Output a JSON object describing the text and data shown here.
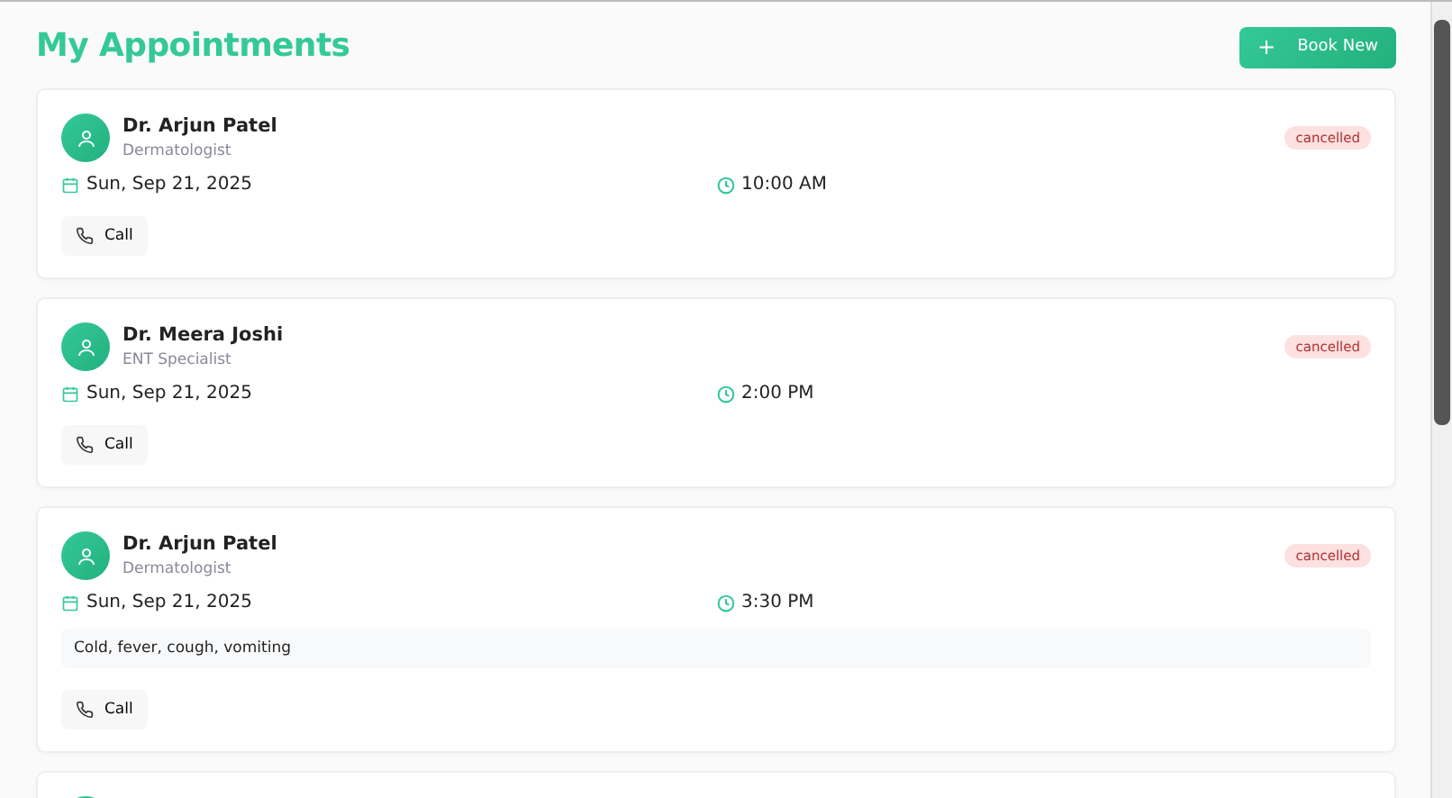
{
  "header": {
    "title": "My Appointments",
    "book_button": {
      "icon": "+",
      "label": "Book New"
    }
  },
  "appointments": [
    {
      "doctor": "Dr. Arjun Patel",
      "specialty": "Dermatologist",
      "status": {
        "label": "cancelled",
        "kind": "cancelled"
      },
      "date": "Sun, Sep 21, 2025",
      "time": "10:00 AM",
      "call_label": "Call"
    },
    {
      "doctor": "Dr. Meera Joshi",
      "specialty": "ENT Specialist",
      "status": {
        "label": "cancelled",
        "kind": "cancelled"
      },
      "date": "Sun, Sep 21, 2025",
      "time": "2:00 PM",
      "call_label": "Call"
    },
    {
      "doctor": "Dr. Arjun Patel",
      "specialty": "Dermatologist",
      "status": {
        "label": "cancelled",
        "kind": "cancelled"
      },
      "date": "Sun, Sep 21, 2025",
      "time": "3:30 PM",
      "notes": "Cold, fever, cough, vomiting",
      "call_label": "Call"
    }
  ]
}
